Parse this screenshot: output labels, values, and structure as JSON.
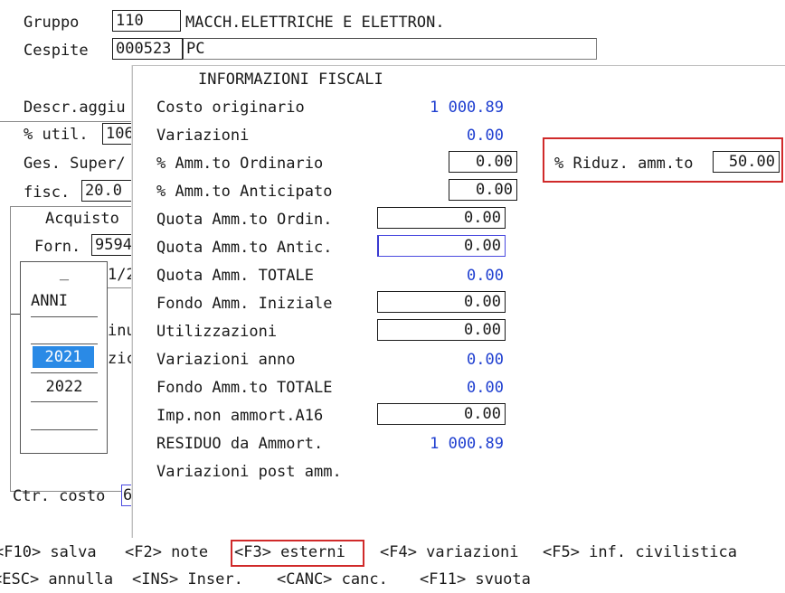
{
  "header": {
    "gruppo_label": "Gruppo",
    "gruppo_code": "110",
    "gruppo_desc": "MACCH.ELETTRICHE E ELETTRON.",
    "cespite_label": "Cespite",
    "cespite_code": "000523",
    "cespite_desc": "PC"
  },
  "background_fields": {
    "descr_label": "Descr.aggiu",
    "util_label": "% util.",
    "util_value": "106",
    "ges_label": "Ges. Super/",
    "fisc_label": "fisc.",
    "fisc_value": "20.0",
    "acquisto_label": "Acquisto",
    "forn_label": "Forn.",
    "forn_value": "9594",
    "partial_1": "1/2",
    "partial_2": "inu",
    "partial_3": "zic",
    "ctr_label": "Ctr. costo",
    "ctr_value": "6"
  },
  "anni_list": {
    "handle": "_",
    "header": "ANNI",
    "years": [
      "2021",
      "2022"
    ],
    "selected": "2021"
  },
  "panel": {
    "title": "INFORMAZIONI FISCALI",
    "rows": {
      "costo_originario": {
        "label": "Costo originario",
        "value": "1 000.89"
      },
      "variazioni": {
        "label": "Variazioni",
        "value": "0.00"
      },
      "amm_ordinario": {
        "label": "% Amm.to Ordinario",
        "value": "0.00"
      },
      "amm_anticipato": {
        "label": "% Amm.to Anticipato",
        "value": "0.00"
      },
      "quota_ordin": {
        "label": "Quota Amm.to Ordin.",
        "value": "0.00"
      },
      "quota_antic": {
        "label": "Quota Amm.to Antic.",
        "value": "0.00"
      },
      "quota_totale": {
        "label": "Quota Amm. TOTALE",
        "value": "0.00"
      },
      "fondo_iniziale": {
        "label": "Fondo Amm. Iniziale",
        "value": "0.00"
      },
      "utilizzazioni": {
        "label": "Utilizzazioni",
        "value": "0.00"
      },
      "variazioni_anno": {
        "label": "Variazioni anno",
        "value": "0.00"
      },
      "fondo_totale": {
        "label": "Fondo Amm.to TOTALE",
        "value": "0.00"
      },
      "imp_non_ammort": {
        "label": "Imp.non ammort.A16",
        "value": "0.00"
      },
      "residuo": {
        "label": "RESIDUO da Ammort.",
        "value": "1 000.89"
      },
      "variazioni_post": {
        "label": "Variazioni post amm."
      }
    },
    "riduz": {
      "label": "% Riduz. amm.to",
      "value": "50.00"
    }
  },
  "footer": {
    "line1": {
      "f10": "<F10> salva",
      "f2": "<F2> note",
      "f3": "<F3> esterni",
      "f4": "<F4> variazioni",
      "f5": "<F5> inf. civilistica"
    },
    "line2": {
      "esc": "<ESC> annulla",
      "ins": "<INS> Inser.",
      "canc": "<CANC> canc.",
      "f11": "<F11> svuota"
    }
  },
  "colors": {
    "value_blue": "#1f3fd0",
    "highlight_red": "#d02a2a",
    "selection_blue": "#2a8ae6"
  }
}
